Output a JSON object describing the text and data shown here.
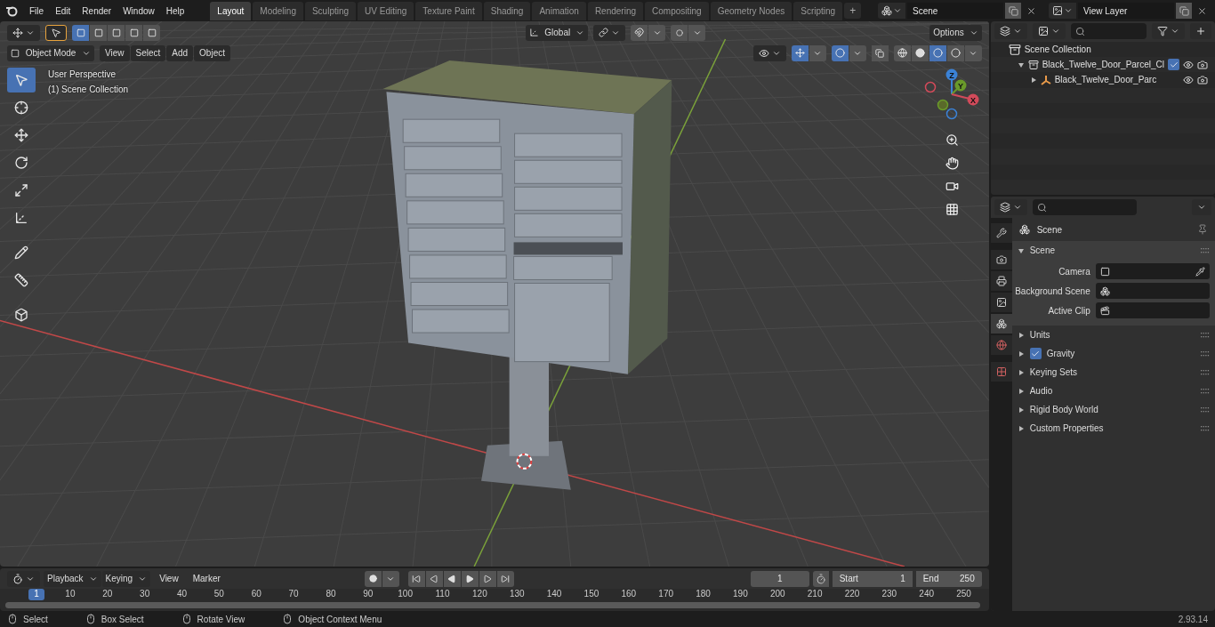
{
  "menu": [
    "File",
    "Edit",
    "Render",
    "Window",
    "Help"
  ],
  "workspaces": [
    {
      "label": "Layout",
      "selected": true
    },
    {
      "label": "Modeling",
      "selected": false
    },
    {
      "label": "Sculpting",
      "selected": false
    },
    {
      "label": "UV Editing",
      "selected": false
    },
    {
      "label": "Texture Paint",
      "selected": false
    },
    {
      "label": "Shading",
      "selected": false
    },
    {
      "label": "Animation",
      "selected": false
    },
    {
      "label": "Rendering",
      "selected": false
    },
    {
      "label": "Compositing",
      "selected": false
    },
    {
      "label": "Geometry Nodes",
      "selected": false
    },
    {
      "label": "Scripting",
      "selected": false
    }
  ],
  "add_workspace": "+",
  "scene": "Scene",
  "view_layer": "View Layer",
  "tool_header": {
    "transform_orientation": "Global",
    "options": "Options"
  },
  "viewport_header": {
    "mode": "Object Mode",
    "menus": [
      "View",
      "Select",
      "Add",
      "Object"
    ]
  },
  "viewport_info": {
    "view": "User Perspective",
    "collection": "(1) Scene Collection"
  },
  "toolbar": [
    {
      "selected": true
    },
    {
      "selected": false
    },
    {
      "selected": false
    },
    {
      "selected": false
    },
    {
      "selected": false
    },
    {
      "selected": false
    },
    {
      "selected": false
    },
    {
      "selected": false
    },
    {
      "selected": false
    }
  ],
  "shading_modes": [
    {
      "selected": false
    },
    {
      "selected": false
    },
    {
      "selected": true
    },
    {
      "selected": false
    }
  ],
  "gizmo_axes": [
    "X",
    "Y",
    "Z"
  ],
  "outliner": {
    "root": "Scene Collection",
    "items": [
      {
        "label": "Black_Twelve_Door_Parcel_Cl",
        "expanded": true,
        "checked": true,
        "children": [
          {
            "label": "Black_Twelve_Door_Parc",
            "expanded": false
          }
        ]
      }
    ]
  },
  "properties": {
    "tabs": [
      {
        "selected": false
      },
      {
        "selected": false
      },
      {
        "selected": false
      },
      {
        "selected": false
      },
      {
        "selected": true
      },
      {
        "selected": false
      },
      {
        "selected": false
      }
    ],
    "context": "Scene",
    "panel": {
      "title": "Scene",
      "expanded": true,
      "fields": [
        {
          "label": "Camera"
        },
        {
          "label": "Background Scene"
        },
        {
          "label": "Active Clip"
        }
      ]
    },
    "subpanels": [
      {
        "title": "Units",
        "kind": "panel"
      },
      {
        "title": "Gravity",
        "kind": "checkbox",
        "checked": true
      },
      {
        "title": "Keying Sets",
        "kind": "panel"
      },
      {
        "title": "Audio",
        "kind": "panel"
      },
      {
        "title": "Rigid Body World",
        "kind": "panel"
      },
      {
        "title": "Custom Properties",
        "kind": "panel"
      }
    ]
  },
  "timeline": {
    "menus": [
      "Playback",
      "Keying",
      "View",
      "Marker"
    ],
    "current_frame": "1",
    "start_label": "Start",
    "start": "1",
    "end_label": "End",
    "end": "250",
    "playhead": "1",
    "ticks": [
      "10",
      "20",
      "30",
      "40",
      "50",
      "60",
      "70",
      "80",
      "90",
      "100",
      "110",
      "120",
      "130",
      "140",
      "150",
      "160",
      "170",
      "180",
      "190",
      "200",
      "210",
      "220",
      "230",
      "240",
      "250"
    ]
  },
  "status_bar": {
    "hints": [
      "Select",
      "Box Select",
      "Rotate View",
      "Object Context Menu"
    ],
    "version": "2.93.14"
  }
}
